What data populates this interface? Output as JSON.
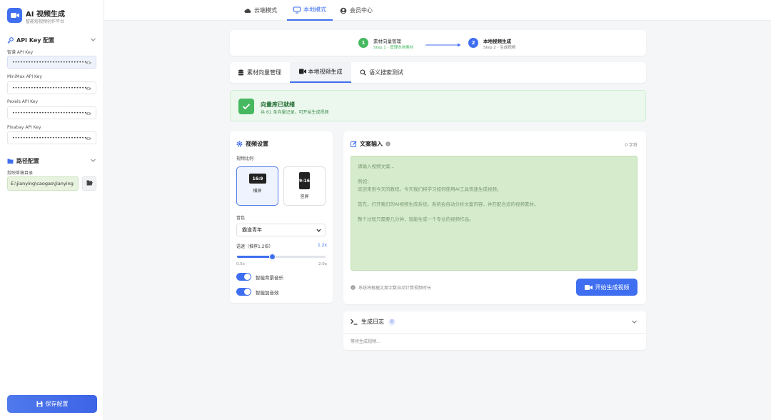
{
  "brand": {
    "title": "AI 视频生成",
    "subtitle": "智能短视频创作平台"
  },
  "api_section": {
    "title": "API Key 配置",
    "fields": [
      {
        "label": "智谱 API Key",
        "value": "••••••••••••••••••••••••••••••••••••••"
      },
      {
        "label": "MiniMax API Key",
        "value": "••••••••••••••••••••••••••••••••••••••"
      },
      {
        "label": "Pexels API Key",
        "value": "••••••••••••••••••••••••••••••••••••••"
      },
      {
        "label": "Pixabay API Key",
        "value": "••••••••••••••••••••••••••••••••••••"
      }
    ]
  },
  "path_section": {
    "title": "路径配置",
    "label": "剪映草稿目录",
    "value": "E:\\jianying\\caogao\\Jianying"
  },
  "save_label": "保存配置",
  "topnav": {
    "tabs": [
      "云端模式",
      "本地模式",
      "会员中心"
    ]
  },
  "steps": [
    {
      "num": "1",
      "title": "素材向量管理",
      "sub": "Step 1 - 管理本地素材"
    },
    {
      "num": "2",
      "title": "本地视频生成",
      "sub": "Step 2 - 生成视频"
    }
  ],
  "subtabs": [
    "素材向量管理",
    "本地视频生成",
    "语义搜索测试"
  ],
  "ready": {
    "title": "向量库已就绪",
    "sub": "共 61 条向量记录，可开始生成视频"
  },
  "settings": {
    "title": "视频设置",
    "ratio_label": "视频比例",
    "ratios": [
      {
        "glyph": "16:9",
        "name": "横屏"
      },
      {
        "glyph": "9:16",
        "name": "竖屏"
      }
    ],
    "voice_label": "音色",
    "voice_value": "霸道青年",
    "speed_label": "语速（推荐1.2倍）",
    "speed_value": "1.2x",
    "speed_fraction": 0.4,
    "speed_min": "0.5x",
    "speed_max": "2.0x",
    "toggles": [
      "智能背景音乐",
      "智能加音效"
    ]
  },
  "text_input": {
    "title": "文案输入",
    "count": "0 字符",
    "placeholder_lines": [
      "请输入视频文案...",
      "",
      "例如：",
      "欢迎来到今天的教程。今天我们将学习如何使用AI工具快速生成视频。",
      "",
      "首先，打开我们的AI视频生成系统。系统会自动分析文案内容，并匹配合适的视频素材。",
      "",
      "整个过程只需要几分钟，就能生成一个专业的视频作品。"
    ],
    "hint": "系统将根据文案字数自动计算视频时长",
    "generate_label": "开始生成视频"
  },
  "log": {
    "title": "生成日志",
    "count": "0",
    "empty": "等待生成视频..."
  },
  "colors": {
    "accent": "#3f6ff0",
    "success": "#46b85f",
    "text_bg": "#d5ebcb"
  }
}
